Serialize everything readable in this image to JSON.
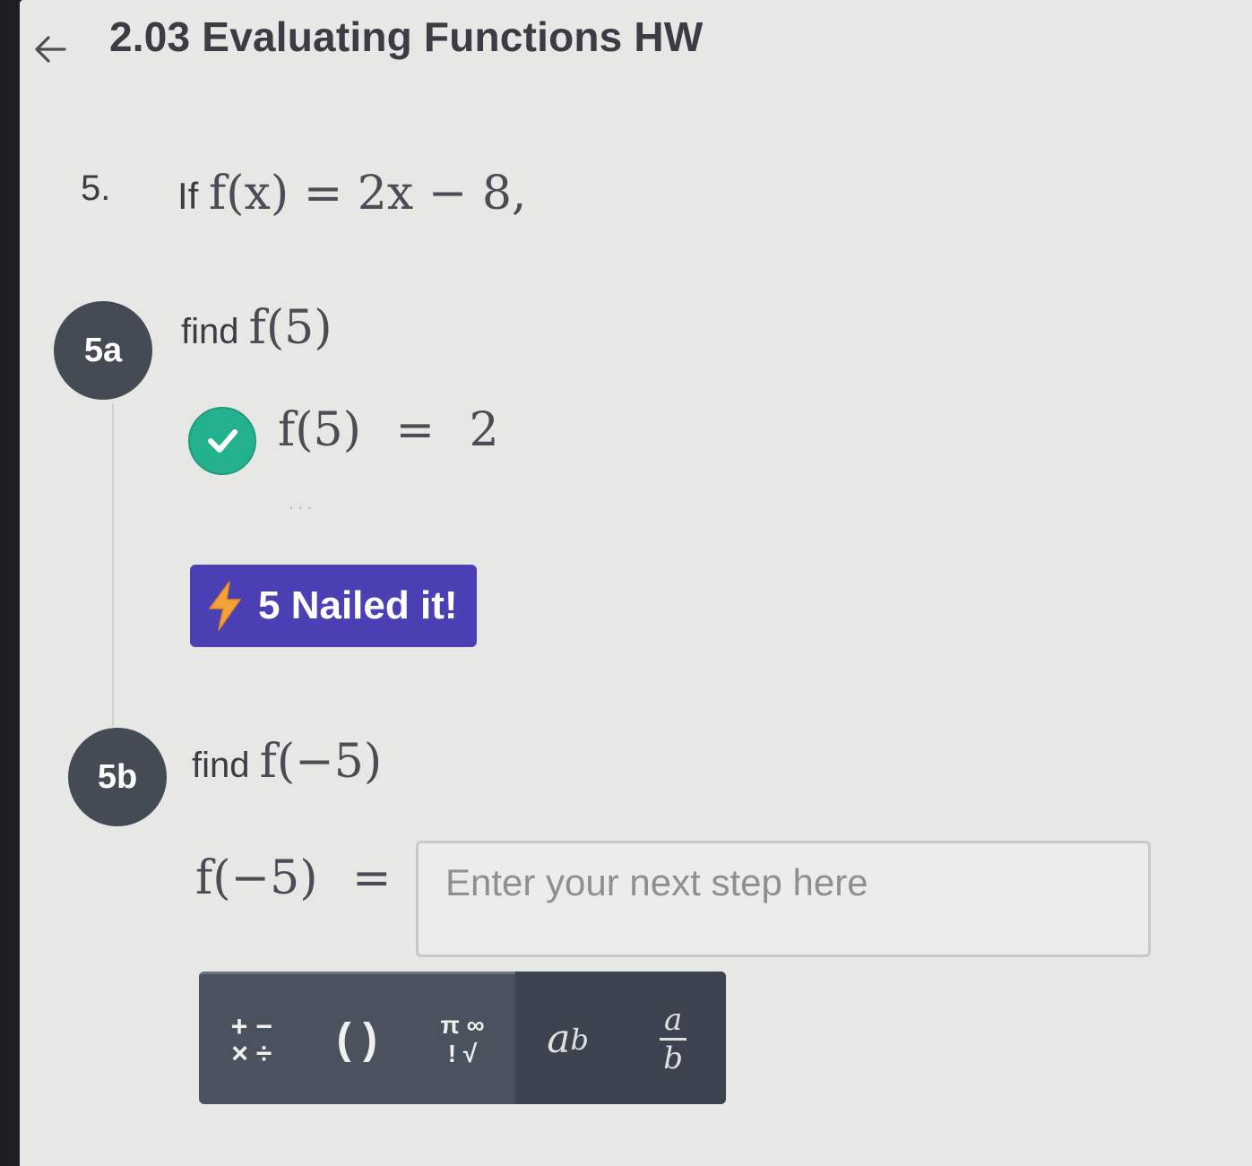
{
  "header": {
    "title": "2.03 Evaluating Functions HW"
  },
  "question": {
    "number": "5.",
    "prefix": "If",
    "expression": "f(x) = 2x − 8,"
  },
  "step_5a": {
    "badge": "5a",
    "prompt_word": "find",
    "prompt_math": "f(5)",
    "answer_lhs": "f(5)",
    "answer_eq": "=",
    "answer_value": "2",
    "status": "correct",
    "more_dots": "...",
    "streak": "5 Nailed it!"
  },
  "step_5b": {
    "badge": "5b",
    "prompt_word": "find",
    "prompt_math": "f(−5)",
    "answer_lhs": "f(−5)",
    "answer_eq": "=",
    "input_placeholder": "Enter your next step here"
  },
  "keypad": {
    "ops_top": "+ −",
    "ops_bottom": "× ÷",
    "parens": "( )",
    "special_top": "π ∞",
    "special_bottom": "! √",
    "power_base": "a",
    "power_exp": "b",
    "frac_num": "a",
    "frac_den": "b"
  },
  "colors": {
    "badge": "#454b55",
    "check": "#24b28e",
    "streak_button": "#4b3fb4",
    "keypad": "#4a525e"
  },
  "icons": [
    "arrow-left-icon",
    "checkmark-icon",
    "lightning-bolt-icon"
  ]
}
